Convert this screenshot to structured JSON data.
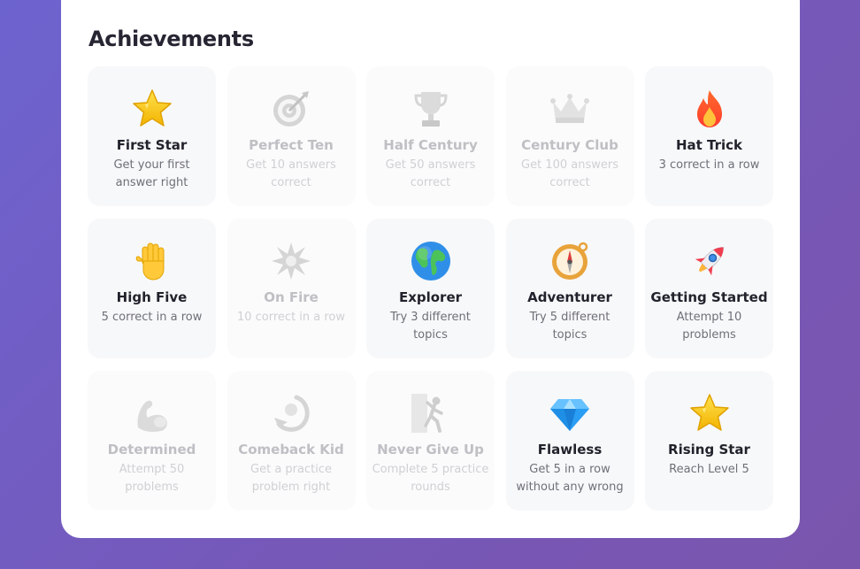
{
  "page": {
    "title": "Achievements"
  },
  "achievements": [
    {
      "name": "First Star",
      "desc": "Get your first answer right",
      "icon": "star-icon",
      "unlocked": true
    },
    {
      "name": "Perfect Ten",
      "desc": "Get 10 answers correct",
      "icon": "target-icon",
      "unlocked": false
    },
    {
      "name": "Half Century",
      "desc": "Get 50 answers correct",
      "icon": "trophy-icon",
      "unlocked": false
    },
    {
      "name": "Century Club",
      "desc": "Get 100 answers correct",
      "icon": "crown-icon",
      "unlocked": false
    },
    {
      "name": "Hat Trick",
      "desc": "3 correct in a row",
      "icon": "fire-icon",
      "unlocked": true
    },
    {
      "name": "High Five",
      "desc": "5 correct in a row",
      "icon": "raised-hand-icon",
      "unlocked": true
    },
    {
      "name": "On Fire",
      "desc": "10 correct in a row",
      "icon": "collision-icon",
      "unlocked": false
    },
    {
      "name": "Explorer",
      "desc": "Try 3 different topics",
      "icon": "globe-icon",
      "unlocked": true
    },
    {
      "name": "Adventurer",
      "desc": "Try 5 different topics",
      "icon": "compass-icon",
      "unlocked": true
    },
    {
      "name": "Getting Started",
      "desc": "Attempt 10 problems",
      "icon": "rocket-icon",
      "unlocked": true
    },
    {
      "name": "Determined",
      "desc": "Attempt 50 problems",
      "icon": "flexed-biceps-icon",
      "unlocked": false
    },
    {
      "name": "Comeback Kid",
      "desc": "Get a practice problem right",
      "icon": "return-arrow-icon",
      "unlocked": false
    },
    {
      "name": "Never Give Up",
      "desc": "Complete 5 practice rounds",
      "icon": "climber-icon",
      "unlocked": false
    },
    {
      "name": "Flawless",
      "desc": "Get 5 in a row without any wrong",
      "icon": "gem-icon",
      "unlocked": true
    },
    {
      "name": "Rising Star",
      "desc": "Reach Level 5",
      "icon": "star-icon",
      "unlocked": true
    }
  ]
}
